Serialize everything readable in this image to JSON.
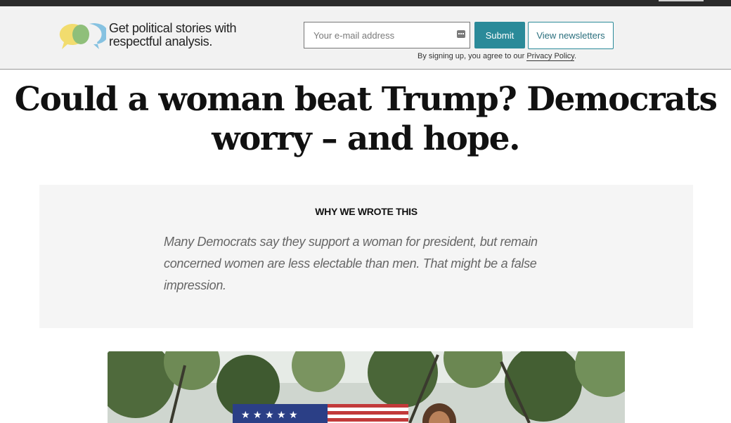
{
  "signup": {
    "tagline": "Get political stories with respectful analysis.",
    "email_placeholder": "Your e-mail address",
    "submit_label": "Submit",
    "newsletters_label": "View newsletters",
    "policy_prefix": "By signing up, you agree to our",
    "policy_link": "Privacy Policy",
    "policy_suffix": "."
  },
  "article": {
    "headline": "Could a woman beat Trump? Democrats worry – and hope.",
    "why_title": "WHY WE WROTE THIS",
    "why_text": "Many Democrats say they support a woman for president, but remain concerned women are less electable than men. That might be a false impression."
  },
  "icons": {
    "logo": "speech-bubbles-logo",
    "email_field": "keyboard-icon"
  },
  "colors": {
    "accent": "#2b8a99",
    "header_bg": "#f2f2f2",
    "logo_yellow": "#f2dc6e",
    "logo_blue": "#7fbfdf",
    "logo_green": "#8fbf7a"
  }
}
